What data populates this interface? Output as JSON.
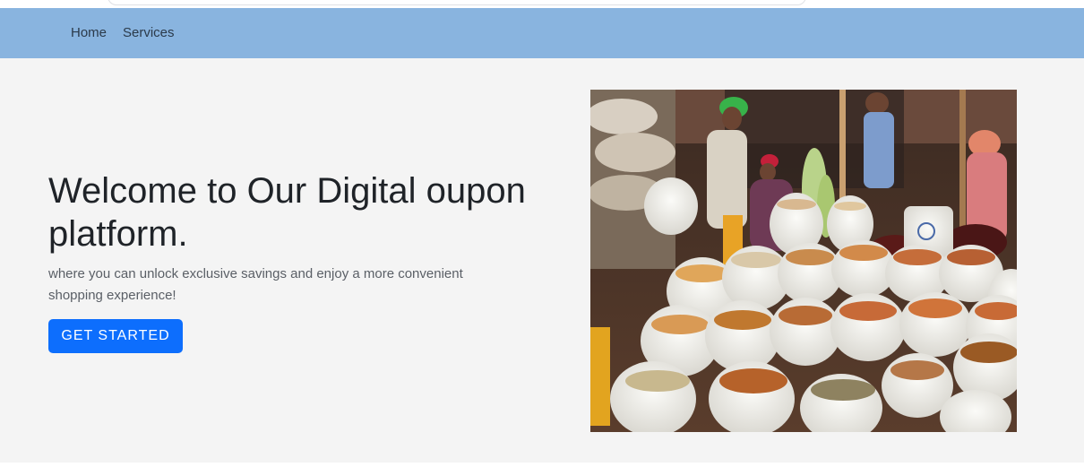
{
  "navbar": {
    "links": [
      {
        "label": "Home"
      },
      {
        "label": "Services"
      }
    ],
    "background": "#89b4df"
  },
  "hero": {
    "title": "Welcome to Our Digital oupon platform.",
    "subtitle": "where you can unlock exclusive savings and enjoy a more convenient shopping experience!",
    "cta_label": "GET STARTED",
    "cta_color": "#0d6efd",
    "image": {
      "semantic": "market-photo",
      "subject": "spice-and-grain-sacks-market"
    }
  }
}
